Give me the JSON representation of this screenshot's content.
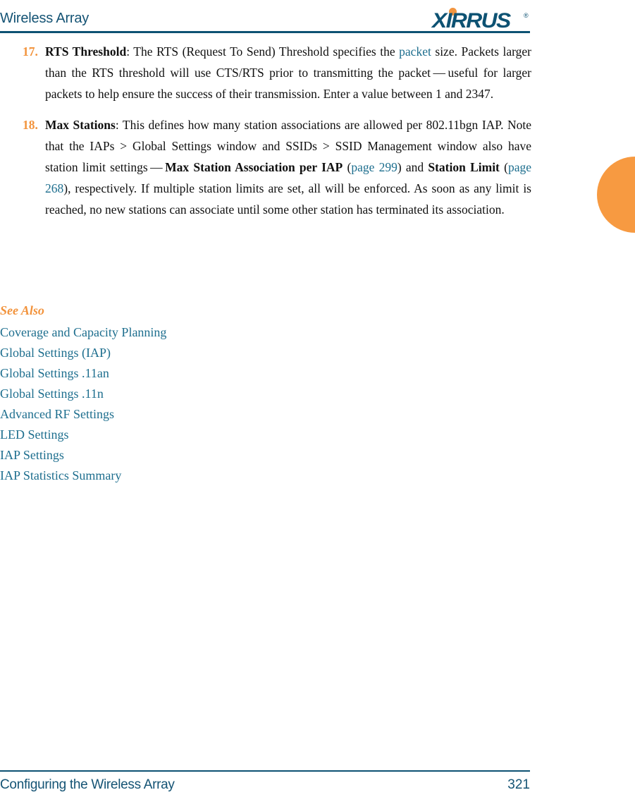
{
  "header": {
    "title": "Wireless Array",
    "logo": {
      "wordmark": "XIRRUS",
      "registered": "®",
      "dot_color": "#f2953f",
      "text_color": "#0d5273"
    },
    "rule_color": "#0d5273"
  },
  "accent": {
    "orange": "#f2933c",
    "teal_link": "#1d6e8e",
    "heading_teal": "#145374",
    "edge_tab": "#f79a41"
  },
  "items": [
    {
      "number": "17.",
      "term": "RTS Threshold",
      "seg1": ": The RTS (Request To Send) Threshold specifies the ",
      "link1": "packet",
      "seg2": " size. Packets larger than the RTS threshold will use CTS/RTS prior to transmitting the packet — useful for larger packets to help ensure the success of their transmission. Enter a value between 1 and 2347."
    },
    {
      "number": "18.",
      "term": "Max Stations",
      "seg1": ": This defines how many station associations are allowed per 802.11bgn IAP. Note that the IAPs > Global Settings window and SSIDs > SSID Management window also have station limit settings — ",
      "term2": "Max Station Association per IAP",
      "seg2": " (",
      "link1": "page 299",
      "seg3": ") and ",
      "term3": "Station Limit",
      "seg4": " (",
      "link2": "page 268",
      "seg5": "), respectively. If multiple station limits are set, all will be enforced. As soon as any limit is reached, no new stations can associate until some other station has terminated its association."
    }
  ],
  "see_also": {
    "heading": "See Also",
    "links": [
      "Coverage and Capacity Planning",
      "Global Settings (IAP)",
      "Global Settings .11an",
      "Global Settings .11n",
      "Advanced RF Settings",
      "LED Settings",
      "IAP Settings",
      "IAP Statistics Summary"
    ]
  },
  "footer": {
    "section": "Configuring the Wireless Array",
    "page_number": "321"
  }
}
